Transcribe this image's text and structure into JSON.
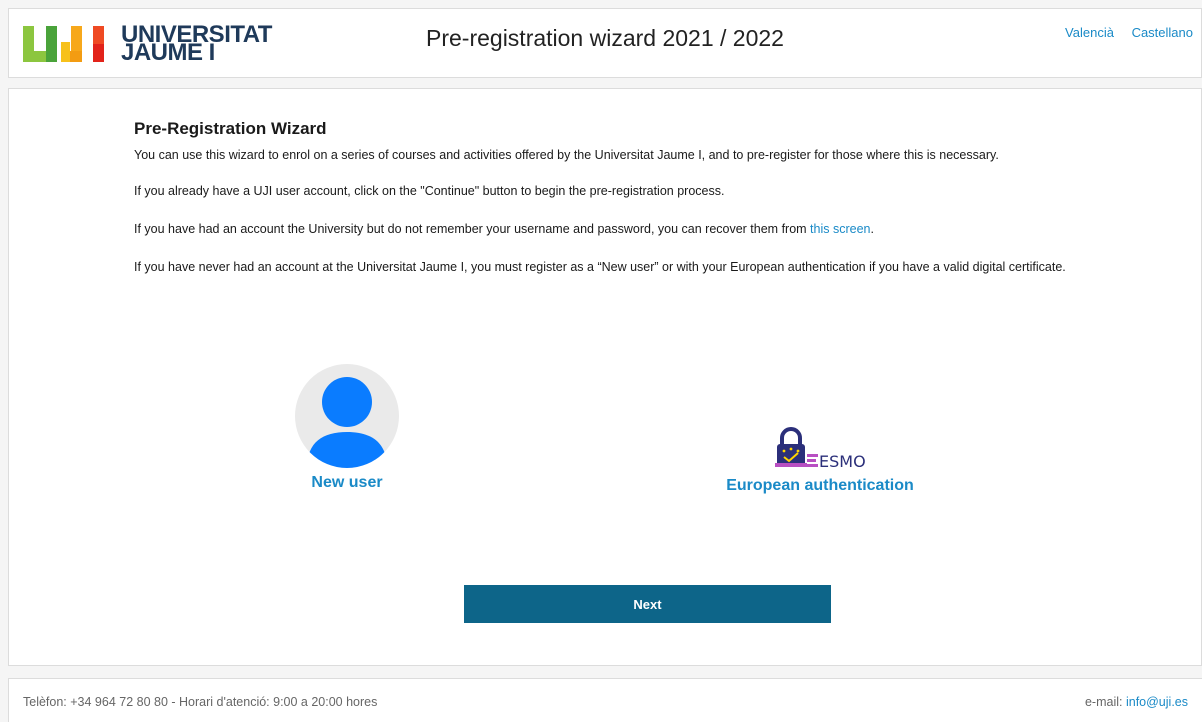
{
  "header": {
    "logo_line1": "UNIVERSITAT",
    "logo_line2": "JAUME I",
    "title": "Pre-registration wizard 2021 / 2022",
    "languages": [
      "Valencià",
      "Castellano"
    ]
  },
  "main": {
    "heading": "Pre-Registration Wizard",
    "paragraphs": {
      "intro": "You can use this wizard to enrol on a series of courses and activities offered by the Universitat Jaume I, and to pre-register for those where this is necessary.",
      "account": "If you already have a UJI user account, click on the \"Continue\" button to begin the pre-registration process.",
      "recover_prefix": "If you have had an account the University but do not remember your username and password, you can recover them from ",
      "recover_link": "this screen",
      "recover_suffix": ".",
      "new_account": "If you have never had an account at the Universitat Jaume I, you must register as a “New user” or with your European authentication if you have a valid digital certificate."
    },
    "options": {
      "new_user": "New user",
      "european_auth": "European authentication",
      "esmo_text": "ESMO"
    },
    "next_label": "Next"
  },
  "footer": {
    "phone_text": "Telèfon: +34 964 72 80 80 - Horari d'atenció: 9:00 a 20:00 hores",
    "email_prefix": "e-mail: ",
    "email": "info@uji.es"
  },
  "colors": {
    "link": "#1a8ac7",
    "button": "#0d6589",
    "avatar_blue": "#0a7cff",
    "logo_navy": "#1f3a5a"
  }
}
